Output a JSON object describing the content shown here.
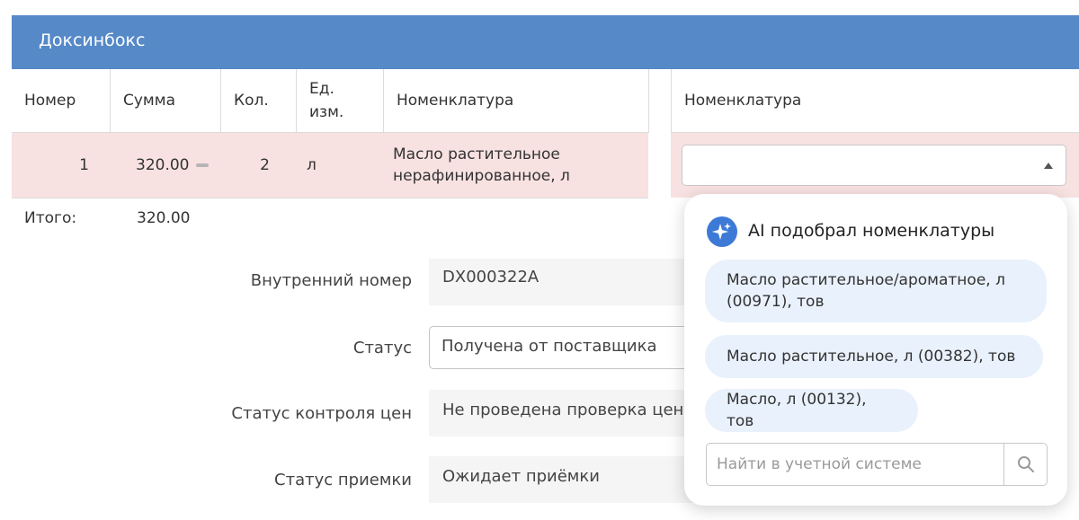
{
  "header": {
    "title": "Доксинбокс"
  },
  "table": {
    "columns": [
      "Номер",
      "Сумма",
      "Кол.",
      "Ед. изм.",
      "Номенклатура"
    ],
    "right_column": "Номенклатура",
    "row": {
      "number": "1",
      "sum": "320.00",
      "qty": "2",
      "unit": "л",
      "nomenclature": "Масло растительное нерафинированное, л"
    },
    "total_label": "Итого:",
    "total_value": "320.00"
  },
  "form": {
    "internal_number_label": "Внутренний номер",
    "internal_number_value": "DX000322A",
    "status_label": "Статус",
    "status_value": "Получена от поставщика",
    "price_control_label": "Статус контроля цен",
    "price_control_value": "Не проведена проверка цен",
    "acceptance_label": "Статус приемки",
    "acceptance_value": "Ожидает приёмки"
  },
  "popup": {
    "title": "AI подобрал номенклатуры",
    "suggestions": [
      "Масло растительное/ароматное, л (00971), тов",
      "Масло растительное, л (00382), тов",
      "Масло, л (00132), тов"
    ],
    "search_placeholder": "Найти в учетной системе"
  },
  "colors": {
    "header_bg": "#5589c8",
    "row_bg": "#f8e1e1",
    "chip_bg": "#e9f1fc",
    "ai_badge": "#3d7ad6"
  }
}
